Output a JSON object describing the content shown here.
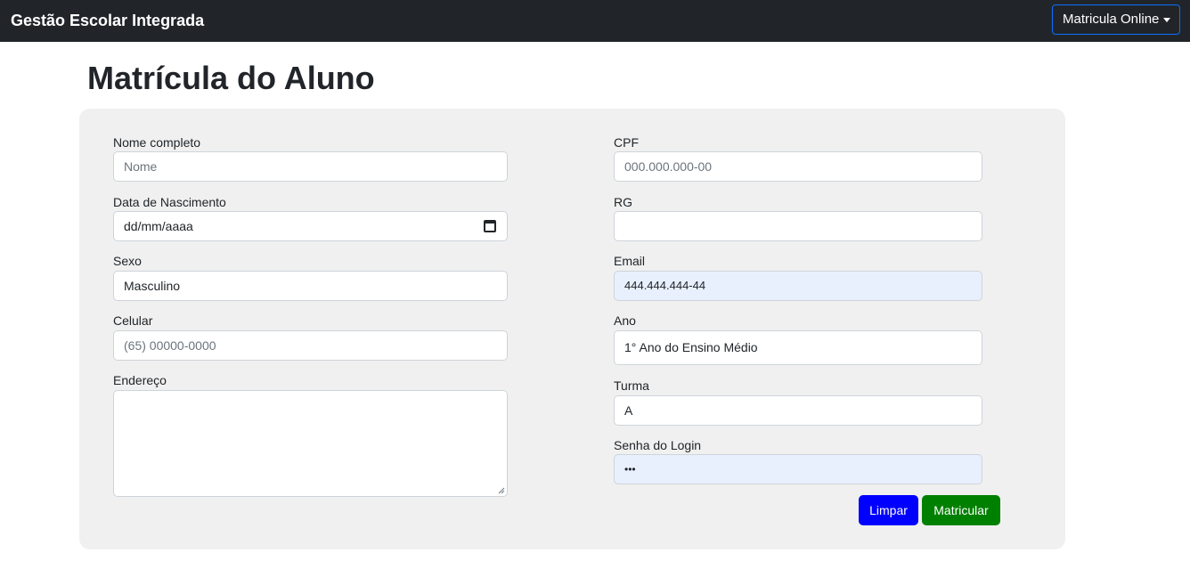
{
  "navbar": {
    "brand": "Gestão Escolar Integrada",
    "dropdown_label": "Matricula Online"
  },
  "page": {
    "title": "Matrícula do Aluno"
  },
  "form": {
    "nome": {
      "label": "Nome completo",
      "placeholder": "Nome",
      "value": ""
    },
    "nascimento": {
      "label": "Data de Nascimento",
      "value": "dd/mm/aaaa"
    },
    "sexo": {
      "label": "Sexo",
      "value": "Masculino"
    },
    "celular": {
      "label": "Celular",
      "placeholder": "(65) 00000-0000",
      "value": ""
    },
    "endereco": {
      "label": "Endereço",
      "value": ""
    },
    "cpf": {
      "label": "CPF",
      "placeholder": "000.000.000-00",
      "value": ""
    },
    "rg": {
      "label": "RG",
      "value": ""
    },
    "email": {
      "label": "Email",
      "value": "444.444.444-44"
    },
    "ano": {
      "label": "Ano",
      "value": "1° Ano do Ensino Médio"
    },
    "turma": {
      "label": "Turma",
      "value": "A"
    },
    "senha": {
      "label": "Senha do Login",
      "value": "•••"
    }
  },
  "buttons": {
    "clear": "Limpar",
    "submit": "Matricular"
  },
  "colors": {
    "navbar_bg": "#212529",
    "panel_bg": "#f0f0f0",
    "clear_button": "#0000ff",
    "submit_button": "#008000",
    "autofill_bg": "#e8f0fe"
  }
}
